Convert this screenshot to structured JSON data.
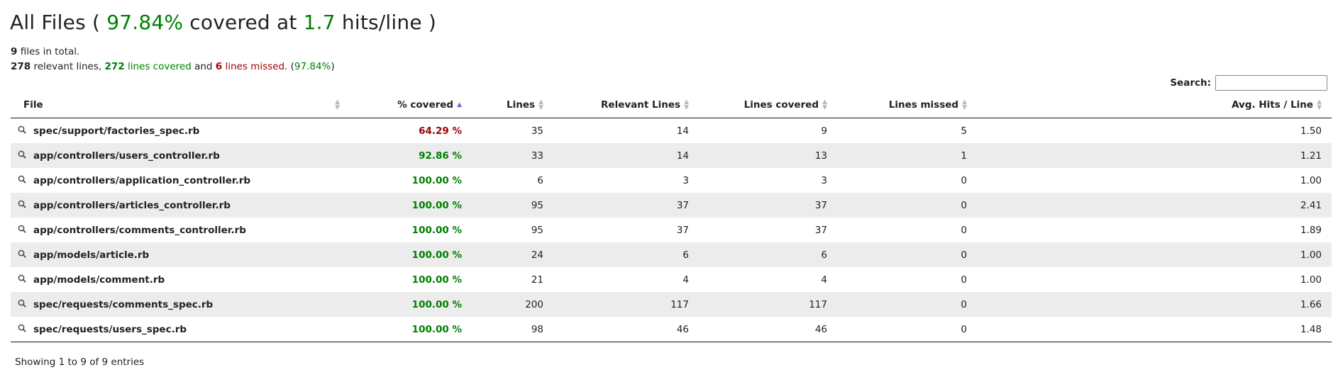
{
  "header": {
    "title_prefix": "All Files (",
    "coverage_percent": "97.84%",
    "title_mid": "covered at",
    "hits_per_line": "1.7",
    "title_suffix": "hits/line )"
  },
  "summary": {
    "file_count": "9",
    "files_text": "files in total.",
    "relevant_lines": "278",
    "relevant_text": "relevant lines,",
    "covered_count": "272",
    "covered_text": "lines covered",
    "and_text": "and",
    "missed_count": "6",
    "missed_text": "lines missed.",
    "percent_open": "(",
    "percent": "97.84%",
    "percent_close": ")"
  },
  "search": {
    "label": "Search:",
    "value": ""
  },
  "table": {
    "columns": [
      "File",
      "% covered",
      "Lines",
      "Relevant Lines",
      "Lines covered",
      "Lines missed",
      "Avg. Hits / Line"
    ],
    "sorted_column": "% covered",
    "sort_direction": "ascending",
    "rows": [
      {
        "file": "spec/support/factories_spec.rb",
        "covered": "64.29 %",
        "lines": "35",
        "relevant": "14",
        "lines_covered": "9",
        "missed": "5",
        "avg": "1.50"
      },
      {
        "file": "app/controllers/users_controller.rb",
        "covered": "92.86 %",
        "lines": "33",
        "relevant": "14",
        "lines_covered": "13",
        "missed": "1",
        "avg": "1.21"
      },
      {
        "file": "app/controllers/application_controller.rb",
        "covered": "100.00 %",
        "lines": "6",
        "relevant": "3",
        "lines_covered": "3",
        "missed": "0",
        "avg": "1.00"
      },
      {
        "file": "app/controllers/articles_controller.rb",
        "covered": "100.00 %",
        "lines": "95",
        "relevant": "37",
        "lines_covered": "37",
        "missed": "0",
        "avg": "2.41"
      },
      {
        "file": "app/controllers/comments_controller.rb",
        "covered": "100.00 %",
        "lines": "95",
        "relevant": "37",
        "lines_covered": "37",
        "missed": "0",
        "avg": "1.89"
      },
      {
        "file": "app/models/article.rb",
        "covered": "100.00 %",
        "lines": "24",
        "relevant": "6",
        "lines_covered": "6",
        "missed": "0",
        "avg": "1.00"
      },
      {
        "file": "app/models/comment.rb",
        "covered": "100.00 %",
        "lines": "21",
        "relevant": "4",
        "lines_covered": "4",
        "missed": "0",
        "avg": "1.00"
      },
      {
        "file": "spec/requests/comments_spec.rb",
        "covered": "100.00 %",
        "lines": "200",
        "relevant": "117",
        "lines_covered": "117",
        "missed": "0",
        "avg": "1.66"
      },
      {
        "file": "spec/requests/users_spec.rb",
        "covered": "100.00 %",
        "lines": "98",
        "relevant": "46",
        "lines_covered": "46",
        "missed": "0",
        "avg": "1.48"
      }
    ]
  },
  "footer": {
    "info": "Showing 1 to 9 of 9 entries"
  },
  "colors": {
    "good": "#008000",
    "bad": "#990000",
    "sort_active": "#5a6fd0",
    "stripe": "#ececec"
  },
  "icons": {
    "file_row": "magnifier-icon",
    "sort": "sort-arrows-icon"
  }
}
